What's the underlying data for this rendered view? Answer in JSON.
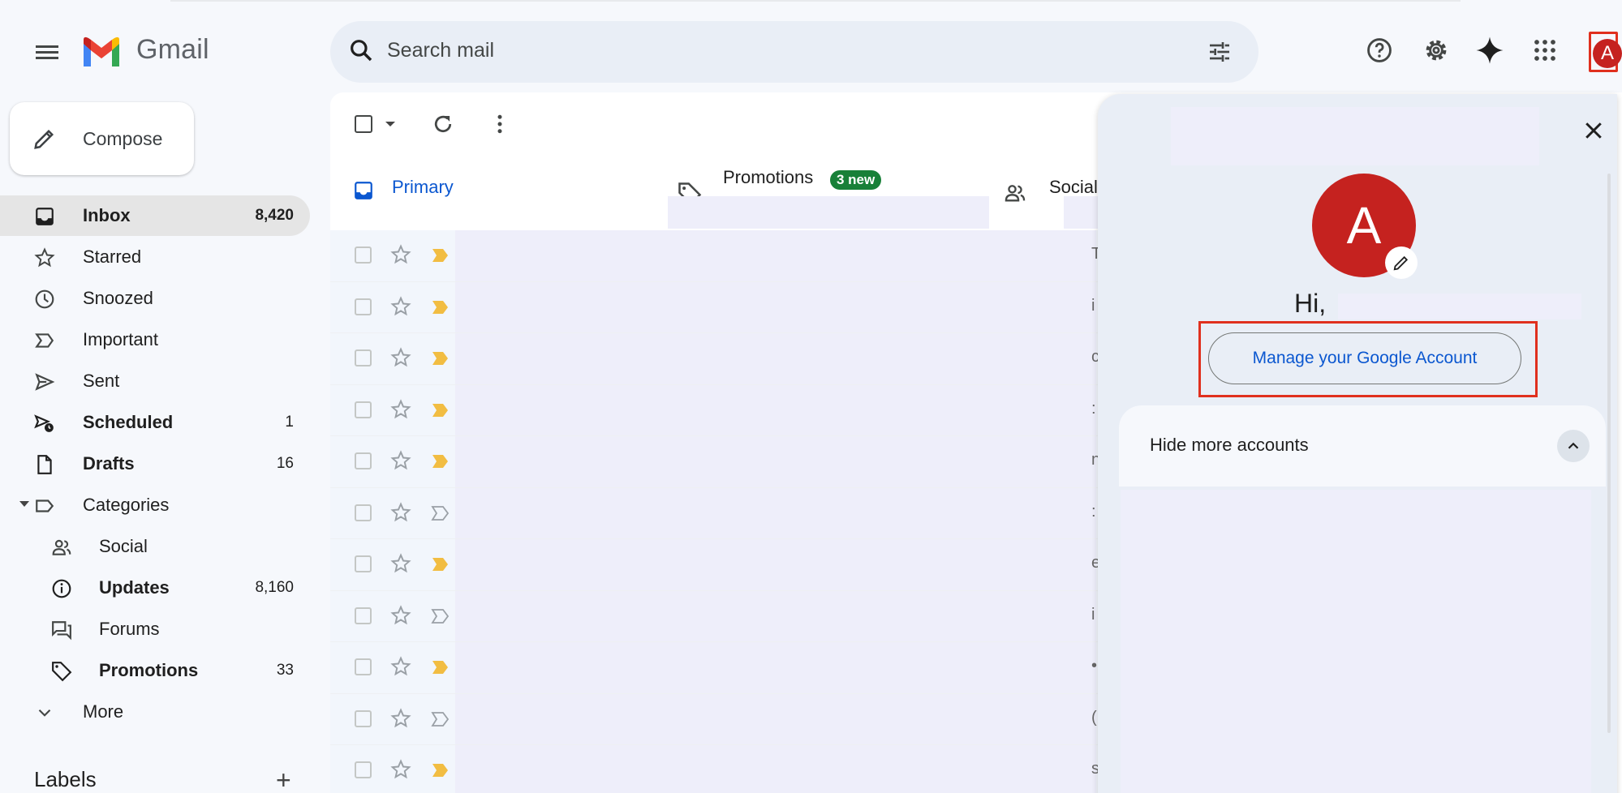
{
  "app": {
    "name": "Gmail"
  },
  "search": {
    "placeholder": "Search mail"
  },
  "header": {
    "icons": [
      "help-icon",
      "gear-icon",
      "sparkle-icon",
      "apps-grid-icon"
    ],
    "avatar_letter": "A",
    "avatar_color": "#c5221f"
  },
  "compose": {
    "label": "Compose"
  },
  "sidebar": {
    "items": [
      {
        "label": "Inbox",
        "count": "8,420",
        "bold": true,
        "active": true,
        "icon": "inbox-icon"
      },
      {
        "label": "Starred",
        "count": "",
        "bold": false,
        "icon": "star-icon"
      },
      {
        "label": "Snoozed",
        "count": "",
        "bold": false,
        "icon": "clock-icon"
      },
      {
        "label": "Important",
        "count": "",
        "bold": false,
        "icon": "important-icon"
      },
      {
        "label": "Sent",
        "count": "",
        "bold": false,
        "icon": "send-icon"
      },
      {
        "label": "Scheduled",
        "count": "1",
        "bold": true,
        "icon": "scheduled-icon"
      },
      {
        "label": "Drafts",
        "count": "16",
        "bold": true,
        "icon": "draft-icon"
      },
      {
        "label": "Categories",
        "count": "",
        "bold": false,
        "icon": "label-icon"
      }
    ],
    "categories": [
      {
        "label": "Social",
        "count": "",
        "bold": false,
        "icon": "people-icon"
      },
      {
        "label": "Updates",
        "count": "8,160",
        "bold": true,
        "icon": "info-icon"
      },
      {
        "label": "Forums",
        "count": "",
        "bold": false,
        "icon": "forum-icon"
      },
      {
        "label": "Promotions",
        "count": "33",
        "bold": true,
        "icon": "tag-icon"
      }
    ],
    "more_label": "More",
    "labels_title": "Labels",
    "add_label": "+"
  },
  "tabs": {
    "primary": "Primary",
    "promotions": "Promotions",
    "promotions_badge": "3 new",
    "social": "Social"
  },
  "rows": [
    {
      "important": true,
      "letter": "T"
    },
    {
      "important": true,
      "letter": "i"
    },
    {
      "important": true,
      "letter": "c"
    },
    {
      "important": true,
      "letter": ":"
    },
    {
      "important": true,
      "letter": "n"
    },
    {
      "important": false,
      "letter": ":"
    },
    {
      "important": true,
      "letter": "e"
    },
    {
      "important": false,
      "letter": "i"
    },
    {
      "important": true,
      "letter": "•"
    },
    {
      "important": false,
      "letter": "("
    },
    {
      "important": true,
      "letter": "s"
    }
  ],
  "account_panel": {
    "avatar_letter": "A",
    "greeting": "Hi,",
    "manage_label": "Manage your Google Account",
    "hide_more_label": "Hide more accounts"
  }
}
